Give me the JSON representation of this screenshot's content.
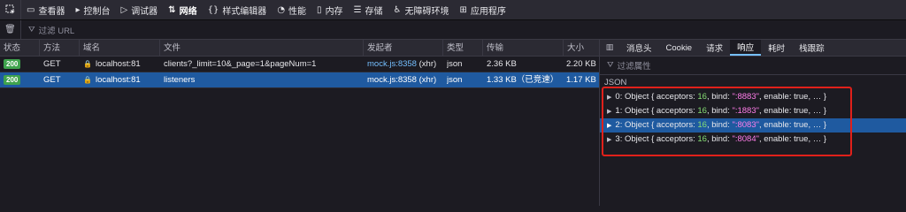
{
  "toolbar": {
    "tabs": [
      {
        "icon": "▭",
        "label": "查看器"
      },
      {
        "icon": "▸",
        "label": "控制台"
      },
      {
        "icon": "▷",
        "label": "调试器"
      },
      {
        "icon": "⇅",
        "label": "网络"
      },
      {
        "icon": "{}",
        "label": "样式编辑器"
      },
      {
        "icon": "◔",
        "label": "性能"
      },
      {
        "icon": "▯",
        "label": "内存"
      },
      {
        "icon": "☰",
        "label": "存储"
      },
      {
        "icon": "♿",
        "label": "无障碍环境"
      },
      {
        "icon": "⊞",
        "label": "应用程序"
      }
    ],
    "active_tab": "网络"
  },
  "filter": {
    "placeholder": "过滤 URL"
  },
  "table": {
    "headers": [
      "状态",
      "方法",
      "域名",
      "文件",
      "发起者",
      "类型",
      "传输",
      "大小"
    ],
    "rows": [
      {
        "status": "200",
        "method": "GET",
        "domain": "localhost:81",
        "file": "clients?_limit=10&_page=1&pageNum=1",
        "initiator": "mock.js:8358",
        "initiator_suffix": " (xhr)",
        "type": "json",
        "transferred": "2.36 KB",
        "size": "2.20 KB"
      },
      {
        "status": "200",
        "method": "GET",
        "domain": "localhost:81",
        "file": "listeners",
        "initiator": "mock.js:8358",
        "initiator_suffix": " (xhr)",
        "type": "json",
        "transferred": "1.33 KB（已竞速）",
        "size": "1.17 KB"
      }
    ]
  },
  "side_panel": {
    "tabs": [
      "消息头",
      "Cookie",
      "请求",
      "响应",
      "耗时",
      "栈跟踪"
    ],
    "active_tab": "响应",
    "filter_placeholder": "过滤属性",
    "section_label": "JSON",
    "tree": [
      {
        "index": "0",
        "acceptors": "16",
        "bind": "\":8883\"",
        "enable": "true"
      },
      {
        "index": "1",
        "acceptors": "16",
        "bind": "\":1883\"",
        "enable": "true"
      },
      {
        "index": "2",
        "acceptors": "16",
        "bind": "\":8083\"",
        "enable": "true"
      },
      {
        "index": "3",
        "acceptors": "16",
        "bind": "\":8084\"",
        "enable": "true"
      }
    ],
    "object_label": "Object",
    "key_acceptors": "acceptors",
    "key_bind": "bind",
    "key_enable": "enable",
    "ellipsis": "…"
  },
  "colors": {
    "selection": "#1f5aa0",
    "status_ok": "#3fa34d",
    "highlight": "#e0201a",
    "link": "#75bfff"
  }
}
